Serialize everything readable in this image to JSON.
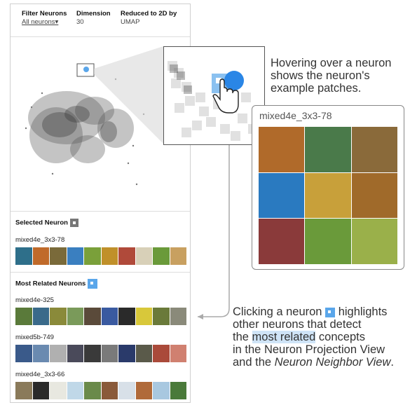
{
  "header": {
    "filter": {
      "title": "Filter Neurons",
      "value": "All neurons"
    },
    "dimension": {
      "title": "Dimension",
      "value": "30"
    },
    "reduced": {
      "title": "Reduced to 2D by",
      "value": "UMAP"
    }
  },
  "selected": {
    "title": "Selected Neuron",
    "name": "mixed4e_3x3-78",
    "patches": [
      "#2e6f8a",
      "#c06a2a",
      "#7a6a3a",
      "#3a7fc0",
      "#7aa03a",
      "#c0902a",
      "#b04a3a",
      "#d8d0b8",
      "#6a9a3a",
      "#c8a060"
    ]
  },
  "related": {
    "title": "Most Related Neurons",
    "neurons": [
      {
        "name": "mixed4e-325",
        "patches": [
          "#5a7a3a",
          "#3a6a8a",
          "#8a8a3a",
          "#7a9a5a",
          "#5a4a3a",
          "#3a5aa0",
          "#2a2a2a",
          "#d8c83a",
          "#6a7a3a",
          "#8a8a7a"
        ]
      },
      {
        "name": "mixed5b-749",
        "patches": [
          "#3a5a8a",
          "#6a8ab0",
          "#b0b0b0",
          "#4a4a5a",
          "#3a3a3a",
          "#7a7a7a",
          "#2a3a6a",
          "#5a5a4a",
          "#aa4a3a",
          "#d08070"
        ]
      },
      {
        "name": "mixed4e_3x3-66",
        "patches": [
          "#8a7a5a",
          "#2a2a2a",
          "#e8e8e0",
          "#c0d8e8",
          "#6a8a4a",
          "#8a5a3a",
          "#d8e0e8",
          "#b06a3a",
          "#a8c8e0",
          "#4a7a3a"
        ]
      }
    ]
  },
  "hover_callout": "Hovering over a neuron shows the neuron's example patches.",
  "card": {
    "title": "mixed4e_3x3-78",
    "patches": [
      "#b06a2a",
      "#4a7a4a",
      "#8a6a3a",
      "#2a7ac0",
      "#c8a03a",
      "#a06a2a",
      "#8a3a3a",
      "#6a9a3a",
      "#9ab04a"
    ]
  },
  "click_callout": {
    "p1": "Clicking a neuron",
    "p2": "highlights",
    "p3": "other neurons that detect",
    "p4": "the",
    "highlight": "most related",
    "p5": "concepts",
    "p6": "in the Neuron Projection View",
    "p7": "and the",
    "italic": "Neuron Neighbor View",
    "p8": "."
  },
  "colors": {
    "accent": "#5aa6ea",
    "highlight": "#cfe4f7"
  }
}
